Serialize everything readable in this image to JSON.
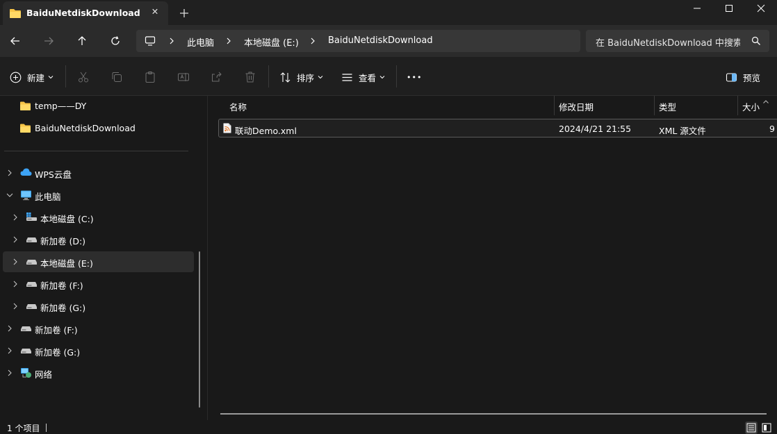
{
  "tab": {
    "title": "BaiduNetdiskDownload",
    "close_glyph": "✕",
    "new_tab_glyph": "+"
  },
  "address": {
    "crumbs": [
      "此电脑",
      "本地磁盘 (E:)",
      "BaiduNetdiskDownload"
    ],
    "search_placeholder": "在 BaiduNetdiskDownload 中搜索"
  },
  "commands": {
    "new_label": "新建",
    "sort_label": "排序",
    "view_label": "查看",
    "more_glyph": "•••",
    "preview_label": "预览"
  },
  "nav": {
    "quick": [
      {
        "label": "temp——DY",
        "icon": "folder-icon"
      },
      {
        "label": "BaiduNetdiskDownload",
        "icon": "folder-icon"
      }
    ],
    "tree": [
      {
        "label": "WPS云盘",
        "icon": "cloud-icon"
      },
      {
        "label": "此电脑",
        "icon": "computer-icon"
      },
      {
        "label": "本地磁盘 (C:)",
        "icon": "windows-drive-icon"
      },
      {
        "label": "新加卷 (D:)",
        "icon": "drive-icon"
      },
      {
        "label": "本地磁盘 (E:)",
        "icon": "drive-icon"
      },
      {
        "label": "新加卷 (F:)",
        "icon": "drive-icon"
      },
      {
        "label": "新加卷 (G:)",
        "icon": "drive-icon"
      },
      {
        "label": "新加卷 (F:)",
        "icon": "drive-icon"
      },
      {
        "label": "新加卷 (G:)",
        "icon": "drive-icon"
      },
      {
        "label": "网络",
        "icon": "network-icon"
      }
    ]
  },
  "columns": {
    "name": "名称",
    "modified": "修改日期",
    "type": "类型",
    "size": "大小"
  },
  "files": [
    {
      "name": "联动Demo.xml",
      "modified": "2024/4/21 21:55",
      "type": "XML 源文件",
      "size": "9"
    }
  ],
  "status": {
    "count_text": "1 个项目"
  },
  "colors": {
    "folder": "#f7c548",
    "background": "#191919",
    "navbar": "#2b2b2b"
  }
}
